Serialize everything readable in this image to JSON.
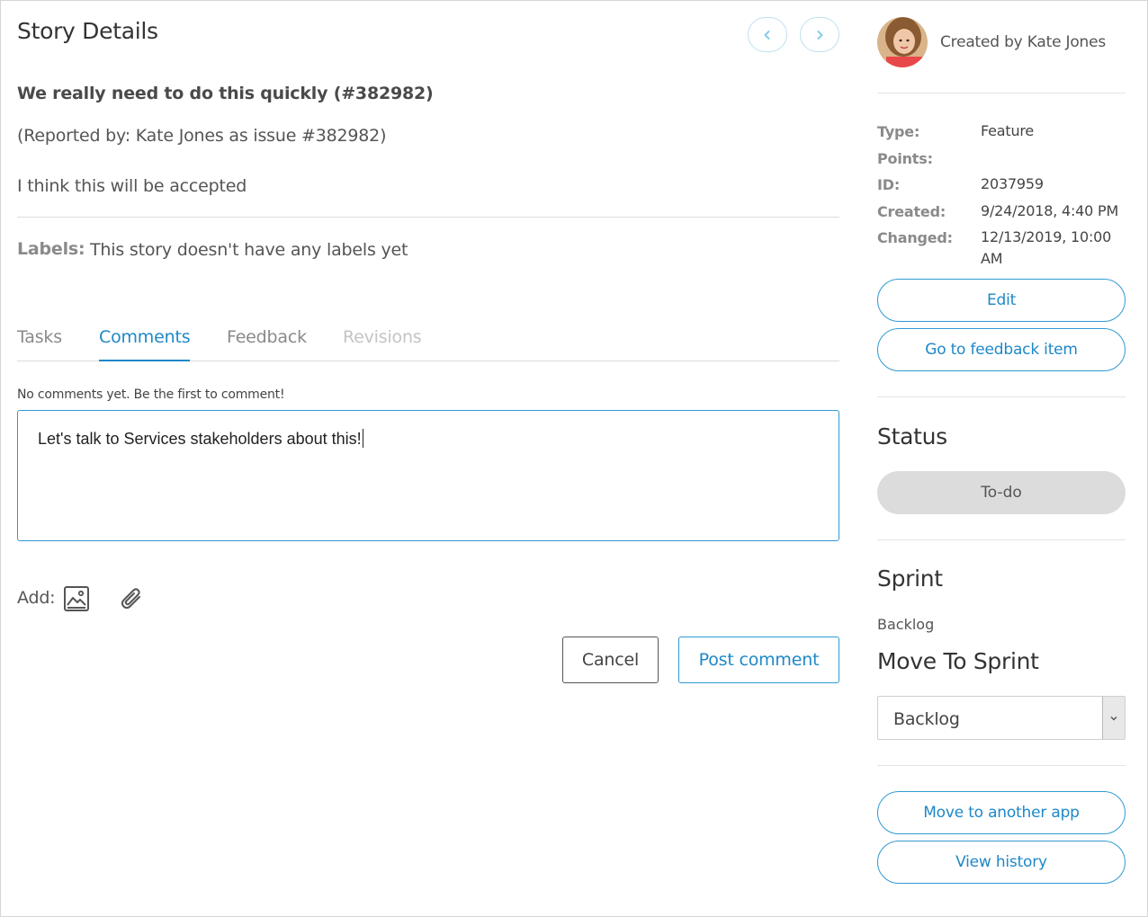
{
  "header": {
    "title": "Story Details",
    "prev_icon": "chevron-left-icon",
    "next_icon": "chevron-right-icon"
  },
  "story": {
    "title": "We really need to do this quickly (#382982)",
    "reported": "(Reported by: Kate Jones as issue #382982)",
    "description": "I think this will be accepted",
    "labels_key": "Labels:",
    "labels_value": "This story doesn't have any labels yet"
  },
  "tabs": [
    {
      "label": "Tasks",
      "state": "normal"
    },
    {
      "label": "Comments",
      "state": "active"
    },
    {
      "label": "Feedback",
      "state": "normal"
    },
    {
      "label": "Revisions",
      "state": "disabled"
    }
  ],
  "comments": {
    "empty_text": "No comments yet. Be the first to comment!",
    "input_value": "Let's talk to Services stakeholders about this!",
    "add_label": "Add:",
    "add_icons": [
      "image-icon",
      "paperclip-icon"
    ],
    "cancel_label": "Cancel",
    "post_label": "Post comment"
  },
  "sidebar": {
    "created_by": "Created by Kate Jones",
    "meta": [
      {
        "key": "Type:",
        "value": "Feature"
      },
      {
        "key": "Points:",
        "value": ""
      },
      {
        "key": "ID:",
        "value": "2037959"
      },
      {
        "key": "Created:",
        "value": "9/24/2018, 4:40 PM"
      },
      {
        "key": "Changed:",
        "value": "12/13/2019, 10:00 AM"
      }
    ],
    "edit_label": "Edit",
    "feedback_label": "Go to feedback item",
    "status_heading": "Status",
    "status_value": "To-do",
    "sprint_heading": "Sprint",
    "sprint_value": "Backlog",
    "move_heading": "Move To Sprint",
    "move_select_value": "Backlog",
    "move_app_label": "Move to another app",
    "history_label": "View history"
  },
  "colors": {
    "accent": "#1e88c8",
    "status_bg": "#dcdcdc"
  }
}
